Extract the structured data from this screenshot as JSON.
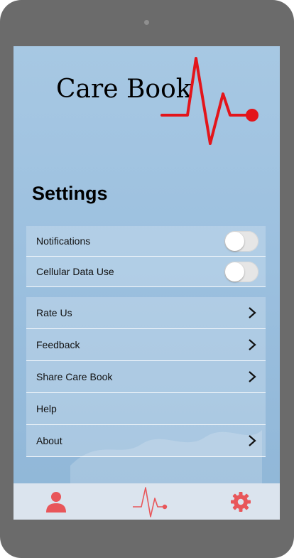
{
  "app": {
    "logo_text": "Care Book"
  },
  "page": {
    "title": "Settings"
  },
  "settings_toggles": [
    {
      "label": "Notifications",
      "enabled": false
    },
    {
      "label": "Cellular Data Use",
      "enabled": false
    }
  ],
  "settings_links": [
    {
      "label": "Rate Us",
      "has_chevron": true
    },
    {
      "label": "Feedback",
      "has_chevron": true
    },
    {
      "label": "Share Care Book",
      "has_chevron": true
    },
    {
      "label": "Help",
      "has_chevron": false
    },
    {
      "label": "About",
      "has_chevron": true
    }
  ],
  "tabbar": {
    "items": [
      {
        "icon": "profile-icon"
      },
      {
        "icon": "heartbeat-icon"
      },
      {
        "icon": "gear-icon"
      }
    ]
  },
  "colors": {
    "accent": "#e8565a",
    "pulse_red": "#e3151b",
    "screen_blue": "#9cc0df"
  }
}
